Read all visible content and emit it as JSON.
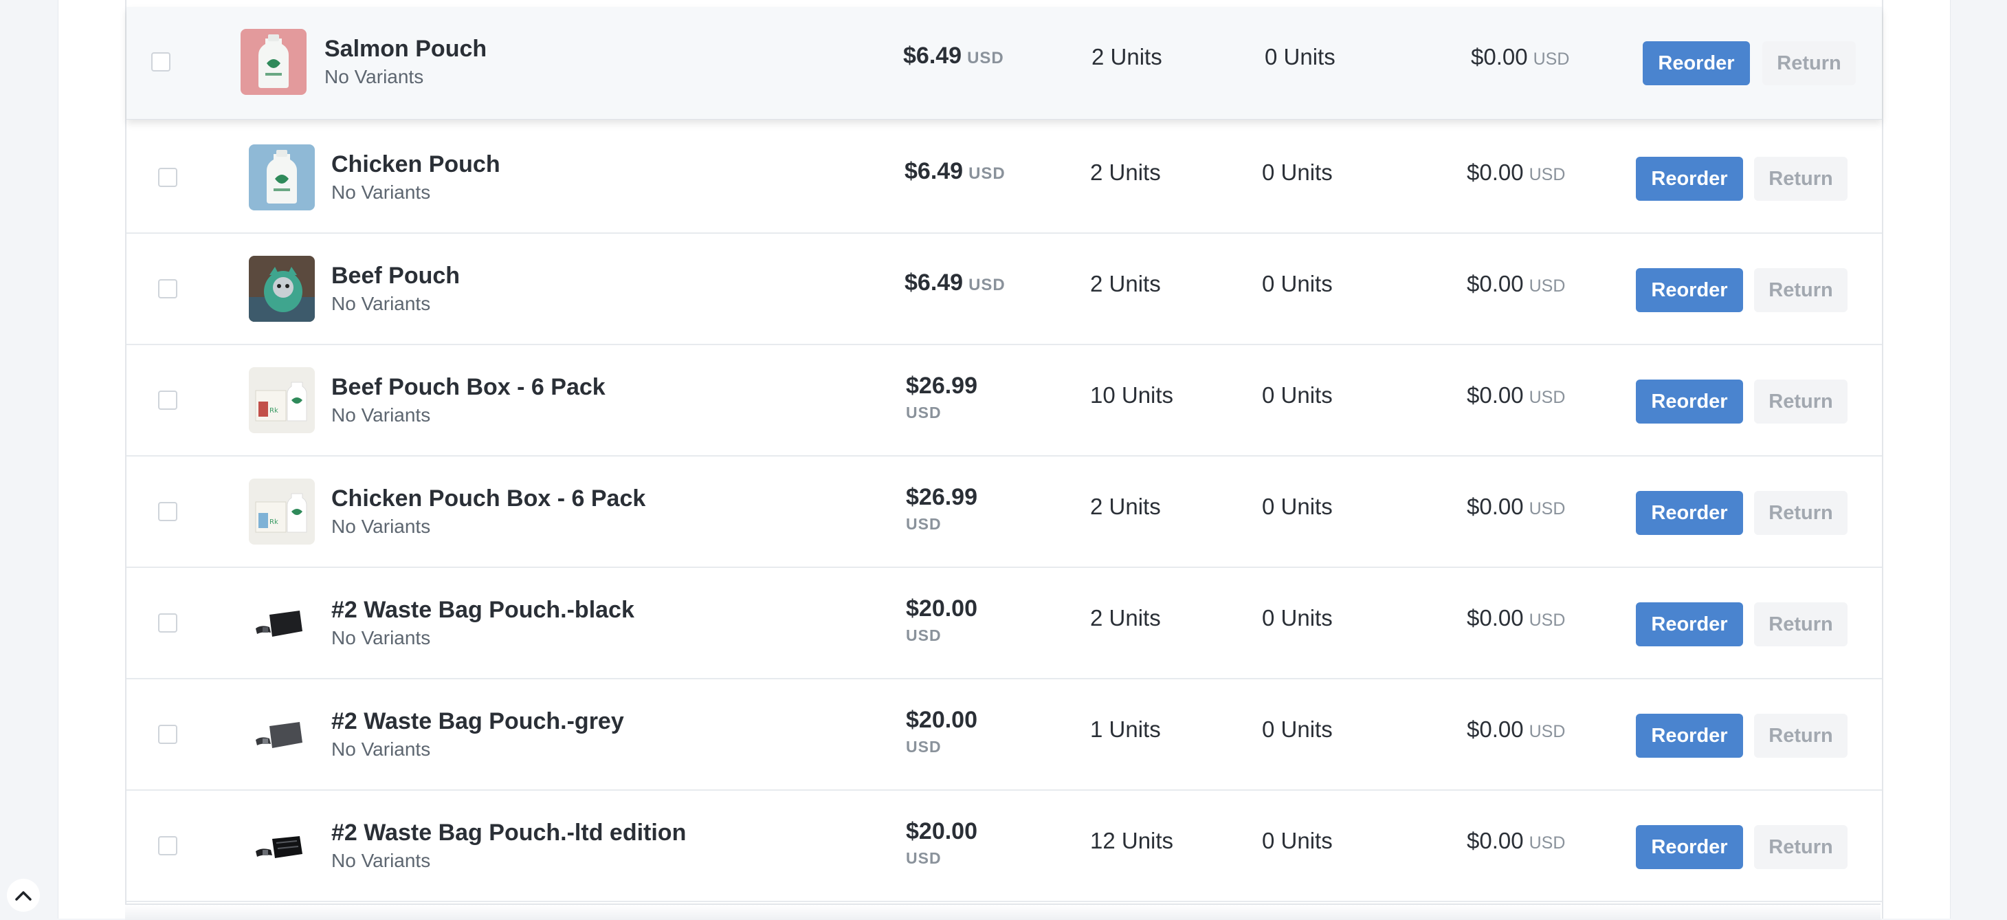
{
  "products": [
    {
      "name": "Salmon Pouch",
      "variant": "No Variants",
      "price": "$6.49",
      "currency": "USD",
      "units_ordered": "2 Units",
      "units_returned": "0 Units",
      "total": "$0.00",
      "total_currency": "USD",
      "reorder_label": "Reorder",
      "return_label": "Return",
      "thumb_icon": "salmon-pouch-image"
    },
    {
      "name": "Chicken Pouch",
      "variant": "No Variants",
      "price": "$6.49",
      "currency": "USD",
      "units_ordered": "2 Units",
      "units_returned": "0 Units",
      "total": "$0.00",
      "total_currency": "USD",
      "reorder_label": "Reorder",
      "return_label": "Return",
      "thumb_icon": "chicken-pouch-image"
    },
    {
      "name": "Beef Pouch",
      "variant": "No Variants",
      "price": "$6.49",
      "currency": "USD",
      "units_ordered": "2 Units",
      "units_returned": "0 Units",
      "total": "$0.00",
      "total_currency": "USD",
      "reorder_label": "Reorder",
      "return_label": "Return",
      "thumb_icon": "beef-pouch-image"
    },
    {
      "name": "Beef Pouch Box - 6 Pack",
      "variant": "No Variants",
      "price": "$26.99",
      "currency": "USD",
      "units_ordered": "10 Units",
      "units_returned": "0 Units",
      "total": "$0.00",
      "total_currency": "USD",
      "reorder_label": "Reorder",
      "return_label": "Return",
      "thumb_icon": "beef-box-image"
    },
    {
      "name": "Chicken Pouch Box - 6 Pack",
      "variant": "No Variants",
      "price": "$26.99",
      "currency": "USD",
      "units_ordered": "2 Units",
      "units_returned": "0 Units",
      "total": "$0.00",
      "total_currency": "USD",
      "reorder_label": "Reorder",
      "return_label": "Return",
      "thumb_icon": "chicken-box-image"
    },
    {
      "name": "#2 Waste Bag Pouch.-black",
      "variant": "No Variants",
      "price": "$20.00",
      "currency": "USD",
      "units_ordered": "2 Units",
      "units_returned": "0 Units",
      "total": "$0.00",
      "total_currency": "USD",
      "reorder_label": "Reorder",
      "return_label": "Return",
      "thumb_icon": "waste-bag-black-image"
    },
    {
      "name": "#2 Waste Bag Pouch.-grey",
      "variant": "No Variants",
      "price": "$20.00",
      "currency": "USD",
      "units_ordered": "1 Units",
      "units_returned": "0 Units",
      "total": "$0.00",
      "total_currency": "USD",
      "reorder_label": "Reorder",
      "return_label": "Return",
      "thumb_icon": "waste-bag-grey-image"
    },
    {
      "name": "#2 Waste Bag Pouch.-ltd edition",
      "variant": "No Variants",
      "price": "$20.00",
      "currency": "USD",
      "units_ordered": "12 Units",
      "units_returned": "0 Units",
      "total": "$0.00",
      "total_currency": "USD",
      "reorder_label": "Reorder",
      "return_label": "Return",
      "thumb_icon": "waste-bag-ltd-image"
    }
  ],
  "colors": {
    "reorder_button": "#4a84cf",
    "return_button_text": "#a2a8b0",
    "row_highlight": "#f6f8fa"
  },
  "scroll_to_top_icon": "chevron-up-icon"
}
